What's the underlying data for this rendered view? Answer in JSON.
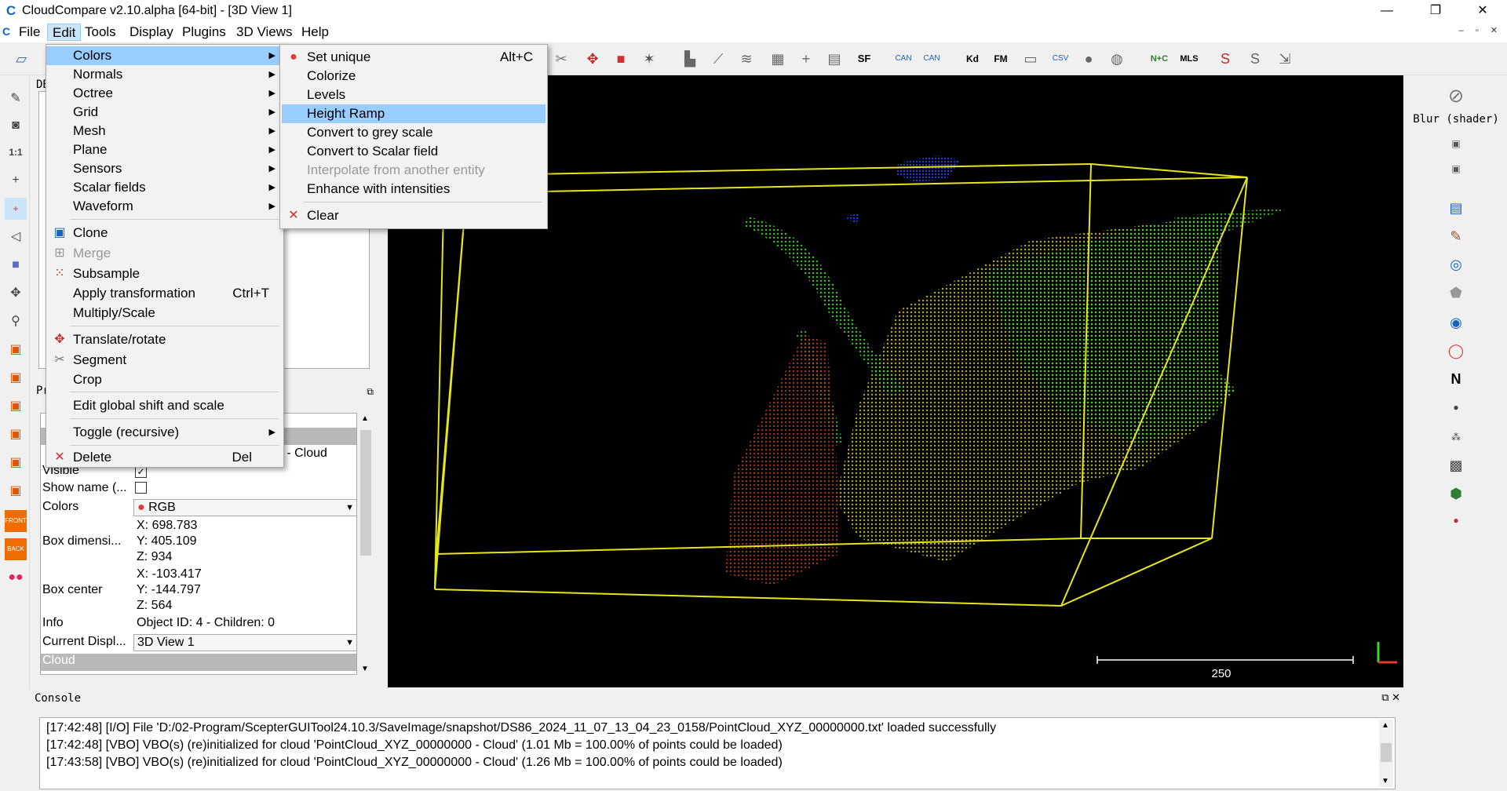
{
  "window": {
    "title": "CloudCompare v2.10.alpha [64-bit] - [3D View 1]",
    "icon": "C",
    "min": "—",
    "max": "❐",
    "close": "✕"
  },
  "menubar": {
    "items": [
      "File",
      "Edit",
      "Tools",
      "Display",
      "Plugins",
      "3D Views",
      "Help"
    ],
    "mdi_controls": "– ▫ ✕"
  },
  "edit_menu": {
    "colors": "Colors",
    "normals": "Normals",
    "octree": "Octree",
    "grid": "Grid",
    "mesh": "Mesh",
    "plane": "Plane",
    "sensors": "Sensors",
    "scalar_fields": "Scalar fields",
    "waveform": "Waveform",
    "clone": "Clone",
    "merge": "Merge",
    "subsample": "Subsample",
    "apply_transformation": "Apply transformation",
    "apply_transformation_sc": "Ctrl+T",
    "multiply_scale": "Multiply/Scale",
    "translate_rotate": "Translate/rotate",
    "segment": "Segment",
    "crop": "Crop",
    "edit_global_shift": "Edit global shift and scale",
    "toggle_recursive": "Toggle (recursive)",
    "delete": "Delete",
    "delete_sc": "Del"
  },
  "colors_menu": {
    "set_unique": "Set unique",
    "set_unique_sc": "Alt+C",
    "colorize": "Colorize",
    "levels": "Levels",
    "height_ramp": "Height Ramp",
    "grey_scale": "Convert to grey scale",
    "to_scalar_field": "Convert to Scalar field",
    "interpolate": "Interpolate from another entity",
    "enhance": "Enhance with intensities",
    "clear": "Clear"
  },
  "panels": {
    "db_tree_title": "DB",
    "properties_title": "Pr"
  },
  "properties": {
    "cloud_name_partial": "0 - Cloud",
    "visible_label": "Visible",
    "visible_checked": true,
    "show_name_label": "Show name (...",
    "show_name_checked": false,
    "colors_label": "Colors",
    "colors_value": "RGB",
    "box_dim_label": "Box dimensi...",
    "box_dim_x": "X: 698.783",
    "box_dim_y": "Y: 405.109",
    "box_dim_z": "Z: 934",
    "box_center_label": "Box center",
    "box_center_x": "X: -103.417",
    "box_center_y": "Y: -144.797",
    "box_center_z": "Z: 564",
    "info_label": "Info",
    "info_value": "Object ID: 4 - Children: 0",
    "current_display_label": "Current Displ...",
    "current_display_value": "3D View 1",
    "section_cloud": "Cloud"
  },
  "view3d": {
    "scale_label": "250",
    "point_colors": {
      "yellow": "#d8cc1a",
      "green": "#3fd82b",
      "red": "#b8401c",
      "blue": "#1f3ee0",
      "bbox": "#e6e61a"
    }
  },
  "right_panel": {
    "blur_label": "Blur (shader)"
  },
  "console": {
    "title": "Console",
    "lines": [
      "[17:42:48] [I/O] File 'D:/02-Program/ScepterGUITool24.10.3/SaveImage/snapshot/DS86_2024_11_07_13_04_23_0158/PointCloud_XYZ_00000000.txt' loaded successfully",
      "[17:42:48] [VBO] VBO(s) (re)initialized for cloud 'PointCloud_XYZ_00000000 - Cloud' (1.01 Mb = 100.00% of points could be loaded)",
      "[17:43:58] [VBO] VBO(s) (re)initialized for cloud 'PointCloud_XYZ_00000000 - Cloud' (1.26 Mb = 100.00% of points could be loaded)"
    ]
  },
  "icons": {
    "toolbar": [
      "open-icon",
      "segment-icon",
      "translate-icon",
      "crop-icon",
      "picking-icon",
      "histogram-icon",
      "sf-icon",
      "kd-icon",
      "fm-icon",
      "csv-icon",
      "sphere-icon",
      "globe-icon",
      "mls-icon"
    ],
    "accent": "#1565c0",
    "menu_highlight": "#99ccff"
  }
}
